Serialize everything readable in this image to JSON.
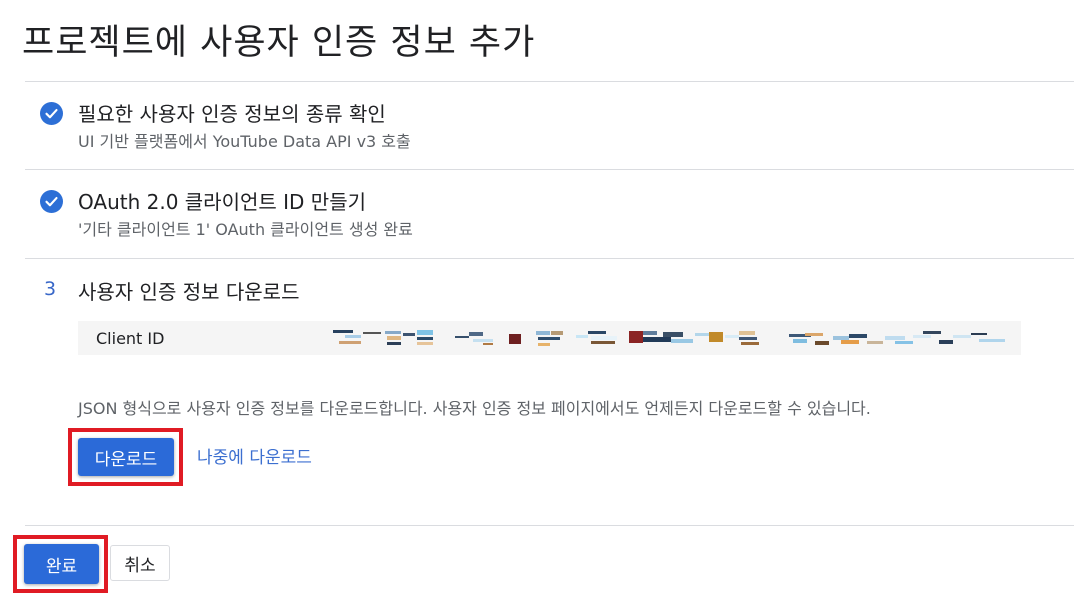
{
  "page": {
    "title": "프로젝트에 사용자 인증 정보 추가"
  },
  "steps": [
    {
      "status": "done",
      "title": "필요한 사용자 인증 정보의 종류 확인",
      "subtitle": "UI 기반 플랫폼에서 YouTube Data API v3 호출"
    },
    {
      "status": "done",
      "title": "OAuth 2.0 클라이언트 ID 만들기",
      "subtitle": "'기타 클라이언트 1' OAuth 클라이언트 생성 완료"
    },
    {
      "status": "current",
      "number": "3",
      "title": "사용자 인증 정보 다운로드"
    }
  ],
  "credentials": {
    "client_id_label": "Client ID"
  },
  "download": {
    "info": "JSON 형식으로 사용자 인증 정보를 다운로드합니다. 사용자 인증 정보 페이지에서도 언제든지 다운로드할 수 있습니다.",
    "download_label": "다운로드",
    "later_label": "나중에 다운로드"
  },
  "footer": {
    "done_label": "완료",
    "cancel_label": "취소"
  },
  "colors": {
    "accent": "#2b6ad8",
    "highlight": "#e01b24",
    "link": "#3c6fd0"
  }
}
